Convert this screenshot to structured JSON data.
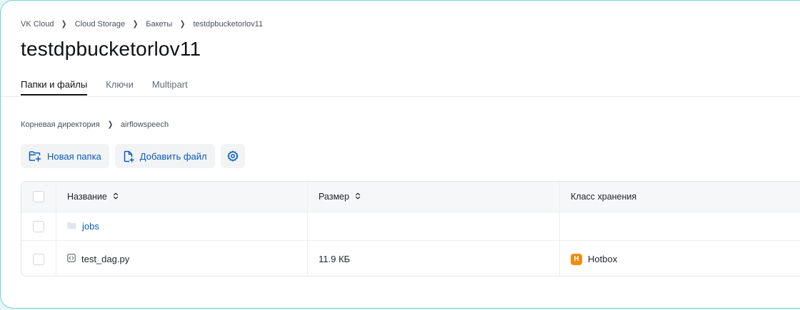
{
  "breadcrumb": {
    "items": [
      "VK Cloud",
      "Cloud Storage",
      "Бакеты",
      "testdpbucketorlov11"
    ],
    "separator": "›"
  },
  "page": {
    "title": "testdpbucketorlov11"
  },
  "tabs": [
    {
      "label": "Папки и файлы",
      "active": true
    },
    {
      "label": "Ключи",
      "active": false
    },
    {
      "label": "Multipart",
      "active": false
    }
  ],
  "path": {
    "items": [
      "Корневая директория",
      "airflowspeech"
    ]
  },
  "toolbar": {
    "new_folder_label": "Новая папка",
    "add_file_label": "Добавить файл",
    "settings_icon": "gear-icon"
  },
  "table": {
    "columns": [
      "Название",
      "Размер",
      "Класс хранения"
    ],
    "rows": [
      {
        "type": "folder",
        "icon": "folder-icon",
        "name": "jobs",
        "size": "",
        "storage_class": ""
      },
      {
        "type": "file",
        "icon": "code-file-icon",
        "name": "test_dag.py",
        "size": "11.9 КБ",
        "storage_class": "Hotbox",
        "storage_badge": "H"
      }
    ]
  },
  "colors": {
    "accent": "#0b5db8",
    "frame_border": "#6fd3d1",
    "hotbox_badge": "#f28c0f"
  }
}
